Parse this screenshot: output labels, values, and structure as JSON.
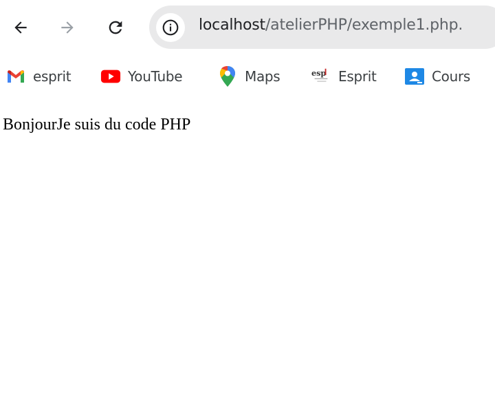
{
  "browser": {
    "address_bar": {
      "host": "localhost",
      "path": "/atelierPHP/exemple1.php."
    },
    "icons": {
      "back": "arrow-left-icon",
      "forward": "arrow-right-icon",
      "reload": "reload-icon",
      "site_info": "info-icon"
    }
  },
  "bookmarks": [
    {
      "label": "esprit",
      "icon": "gmail-icon"
    },
    {
      "label": "YouTube",
      "icon": "youtube-icon"
    },
    {
      "label": "Maps",
      "icon": "maps-icon"
    },
    {
      "label": "Esprit",
      "icon": "esprit-logo-icon"
    },
    {
      "label": "Cours",
      "icon": "classroom-icon"
    }
  ],
  "page": {
    "body_text": "BonjourJe suis du code PHP"
  },
  "colors": {
    "omnibox_bg": "#e9e9ea",
    "host_text": "#202124",
    "path_text": "#5f6368",
    "youtube_red": "#ff0000",
    "classroom_blue": "#1e88e5"
  }
}
